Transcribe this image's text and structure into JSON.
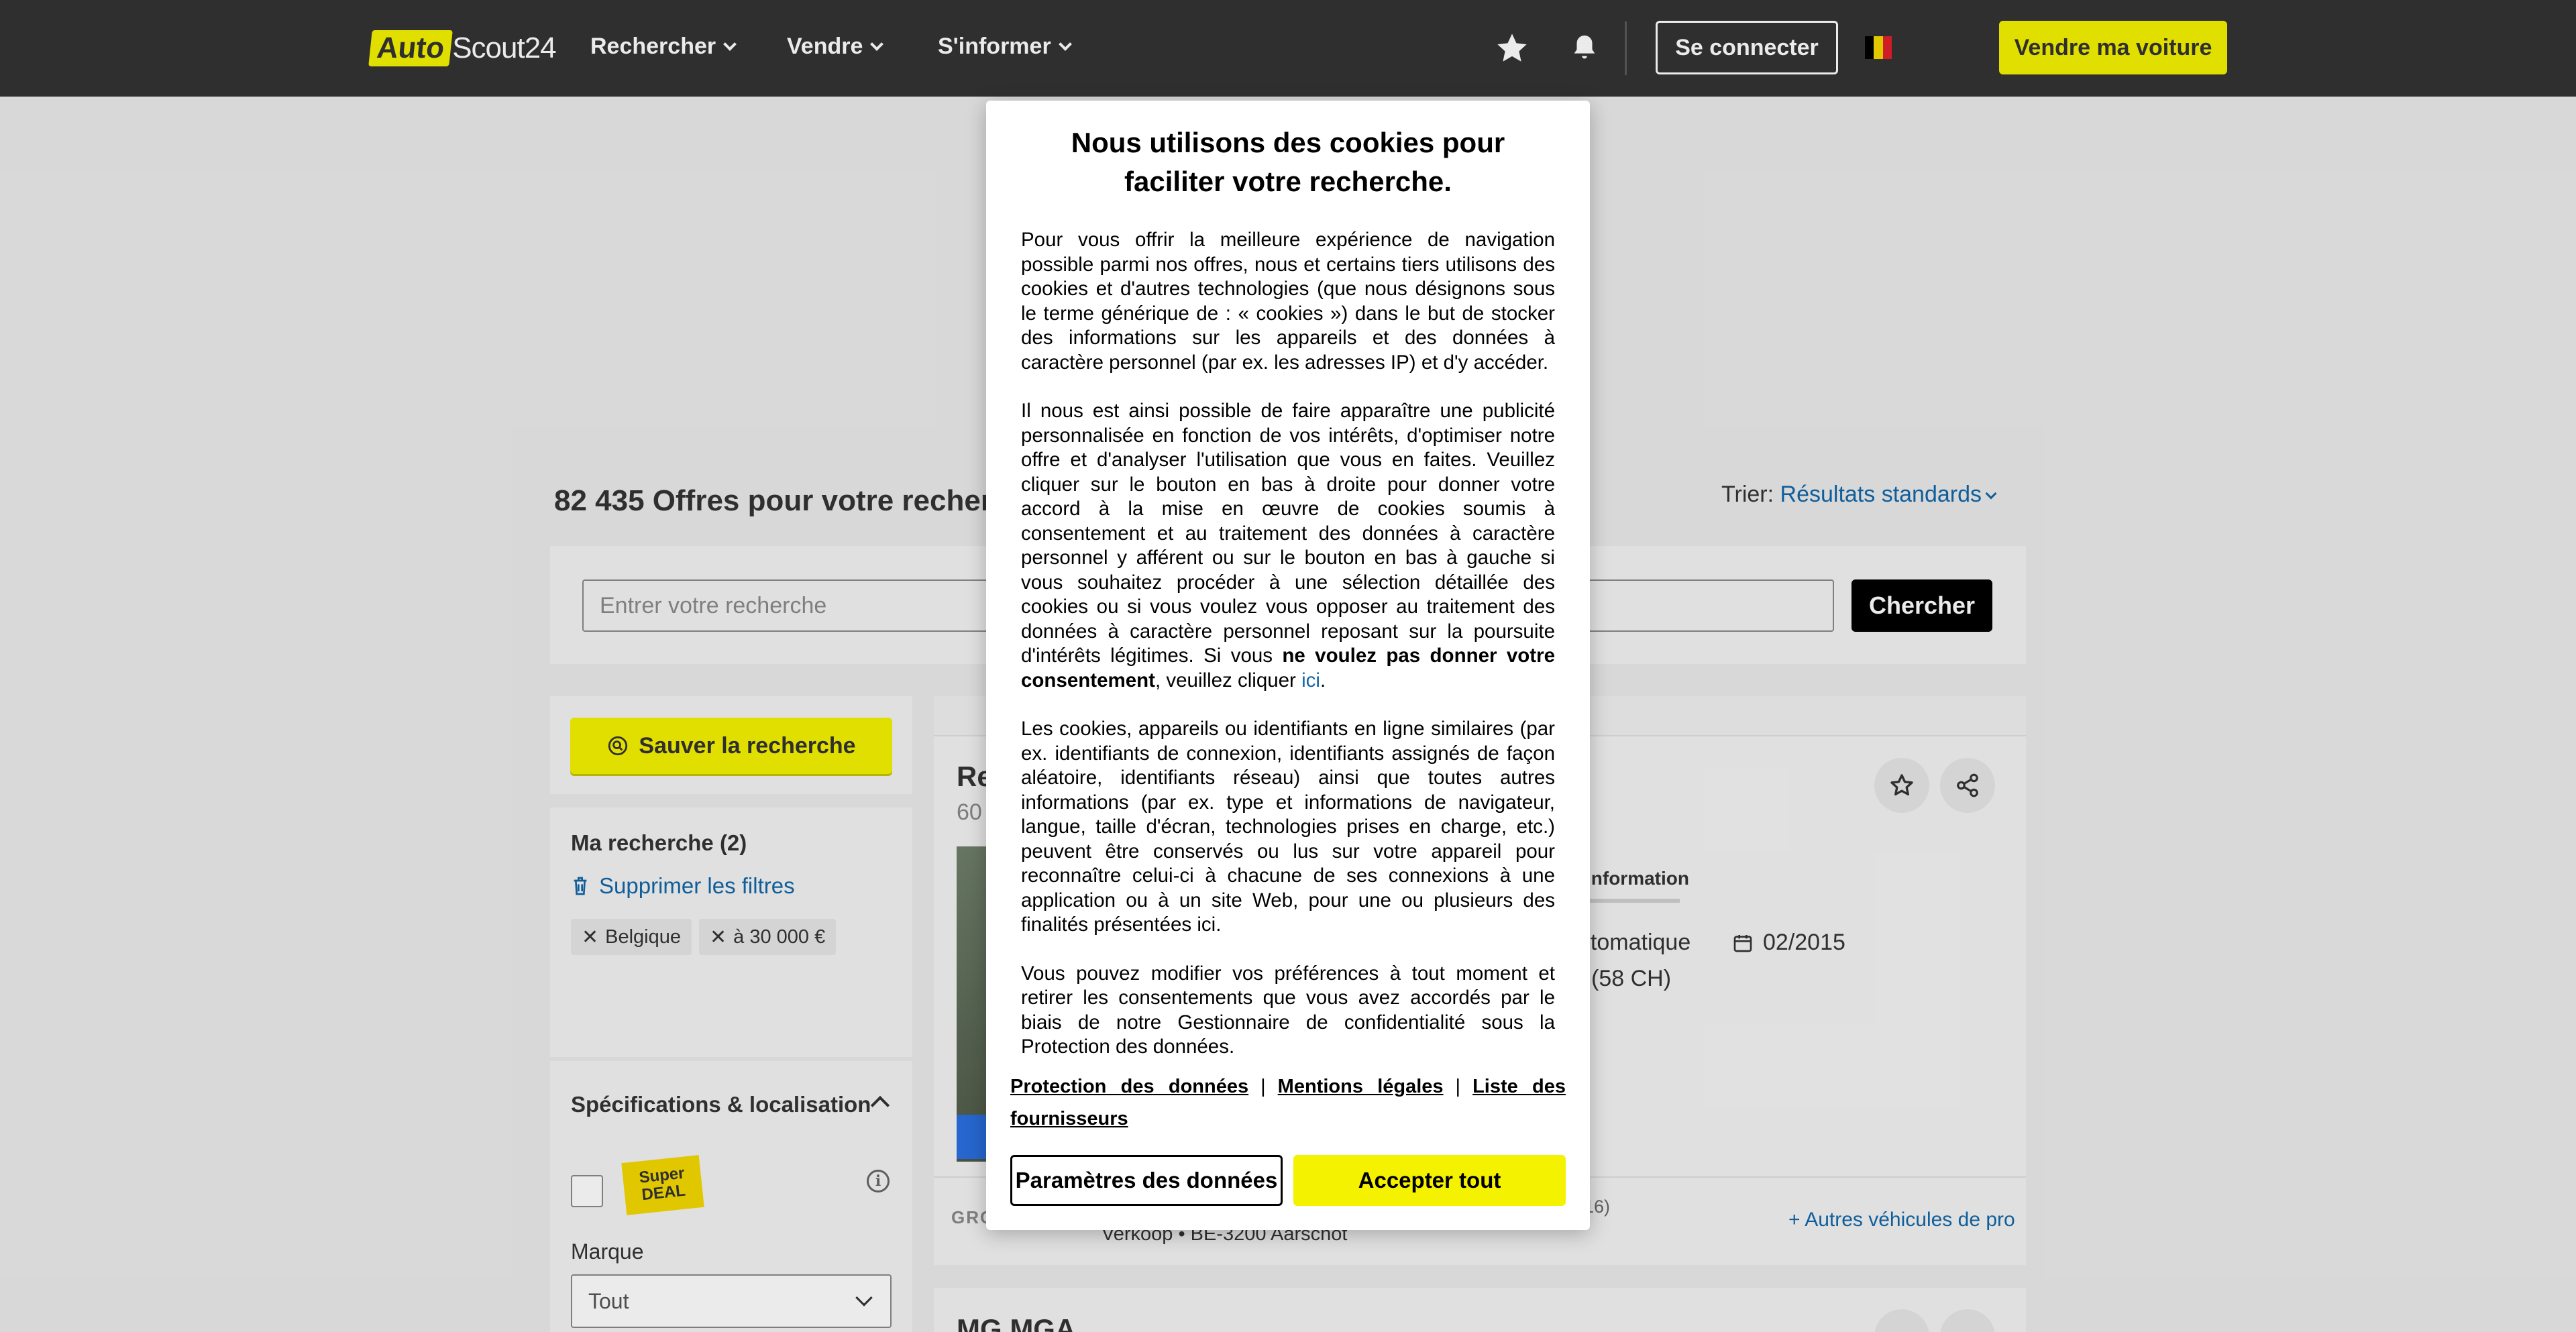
{
  "header": {
    "logo_part1": "Auto",
    "logo_part2": "Scout24",
    "nav": [
      {
        "label": "Rechercher"
      },
      {
        "label": "Vendre"
      },
      {
        "label": "S'informer"
      }
    ],
    "login_label": "Se connecter",
    "sell_label": "Vendre ma voiture",
    "colors": {
      "bg": "#333333",
      "accent": "#f5f200"
    }
  },
  "results": {
    "count_title": "82 435 Offres pour votre recherche",
    "sort_prefix": "Trier:",
    "sort_value": "Résultats standards"
  },
  "search": {
    "placeholder": "Entrer votre recherche",
    "button_label": "Chercher"
  },
  "sidebar": {
    "save_label": "Sauver la recherche",
    "my_search_title": "Ma recherche (2)",
    "clear_filters_label": "Supprimer les filtres",
    "chips": [
      {
        "label": "Belgique"
      },
      {
        "label": "à 30 000 €"
      }
    ],
    "spec_title": "Spécifications & localisation",
    "super_deal_line1": "Super",
    "super_deal_line2": "DEAL",
    "brand_label": "Marque",
    "brand_value": "Tout"
  },
  "listing": {
    "title_partial": "Re",
    "sub_partial": "60",
    "tab_info": "information",
    "transmission_partial": "utomatique",
    "power_partial": "(58 CH)",
    "date": "02/2015",
    "dealer_rating": "(16)",
    "dealer_location": "Verkoop • BE-3200 Aarschot",
    "dealer_more": "+ Autres véhicules de pro",
    "dealer_logo_partial": "GROL",
    "next_title": "MG MGA"
  },
  "modal": {
    "title": "Nous utilisons des cookies pour faciliter votre recherche.",
    "p1": "Pour vous offrir la meilleure expérience de navigation possible parmi nos offres, nous et certains tiers utilisons des cookies et d'autres technologies (que nous désignons sous le terme générique de : « cookies ») dans le but de stocker des informations sur les appareils et des données à caractère personnel (par ex. les adresses IP) et d'y accéder.",
    "p2_a": "Il nous est ainsi possible de faire apparaître une publicité personnalisée en fonction de vos intérêts, d'optimiser notre offre et d'analyser l'utilisation que vous en faites. Veuillez cliquer sur le bouton en bas à droite pour donner votre accord à la mise en œuvre de cookies soumis à consentement et au traitement des données à caractère personnel y afférent ou sur le bouton en bas à gauche si vous souhaitez procéder à une sélection détaillée des cookies ou si vous voulez vous opposer au traitement des données à caractère personnel reposant sur la poursuite d'intérêts légitimes. Si vous",
    "p2_bold": "ne voulez pas donner votre consentement",
    "p2_b": ", veuillez cliquer",
    "p2_link": "ici",
    "p2_end": ".",
    "p3": "Les cookies, appareils ou identifiants en ligne similaires (par ex. identifiants de connexion, identifiants assignés de façon aléatoire, identifiants réseau) ainsi que toutes autres informations (par ex. type et informations de navigateur, langue, taille d'écran, technologies prises en charge, etc.) peuvent être conservés ou lus sur votre appareil pour reconnaître celui-ci à chacune de ses connexions à une application ou à un site Web, pour une ou plusieurs des finalités présentées ici.",
    "p4": "Vous pouvez modifier vos préférences à tout moment et retirer les consentements que vous avez accordés par le biais de notre Gestionnaire de confidentialité sous la Protection des données.",
    "link_privacy": "Protection des données",
    "link_legal": "Mentions légales",
    "link_vendors": "Liste des fournisseurs",
    "separator": "|",
    "btn_params": "Paramètres des données",
    "btn_accept": "Accepter tout"
  }
}
